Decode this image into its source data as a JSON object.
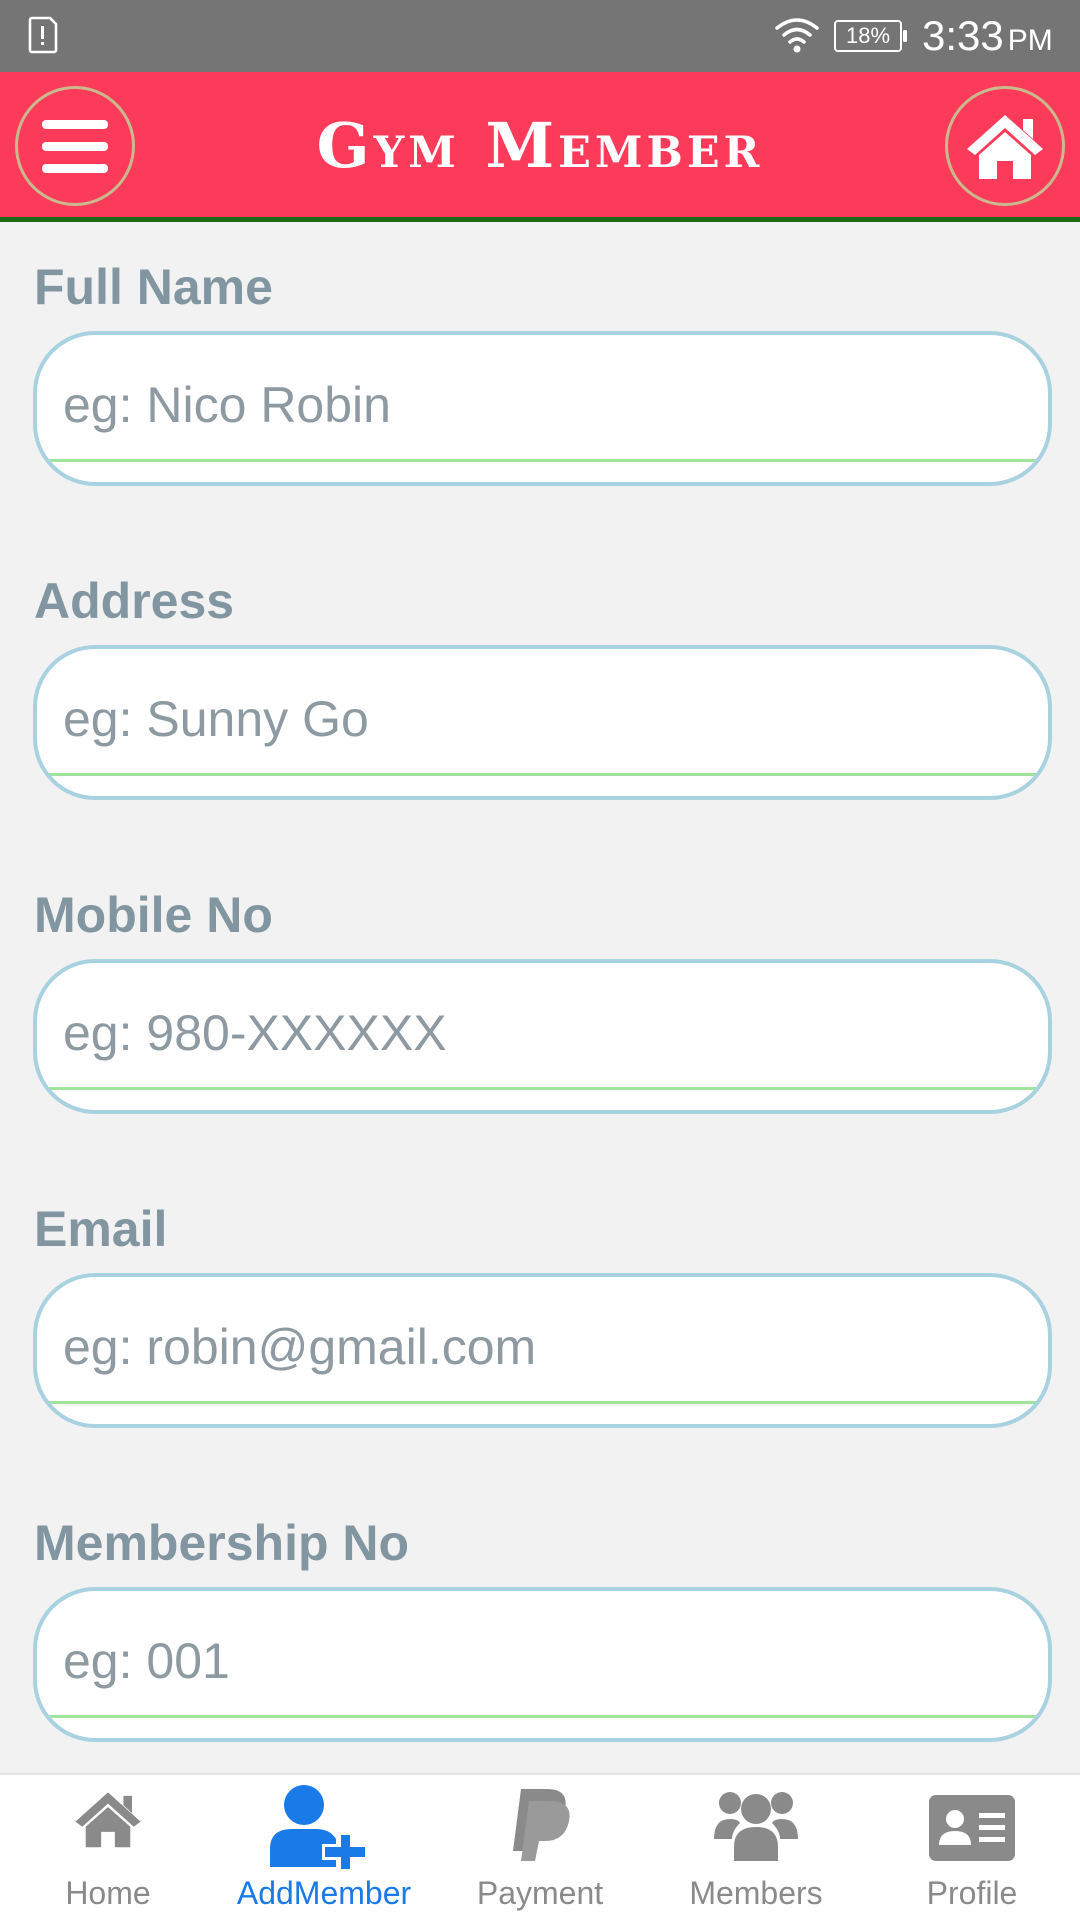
{
  "status_bar": {
    "battery": "18%",
    "time": "3:33",
    "ampm": "PM"
  },
  "header": {
    "title": "Gym Member",
    "menu_icon": "hamburger-menu-icon",
    "home_icon": "home-icon",
    "background_color": "#fc3b5a"
  },
  "form": {
    "fields": [
      {
        "label": "Full Name",
        "placeholder": "eg: Nico Robin",
        "value": ""
      },
      {
        "label": "Address",
        "placeholder": "eg: Sunny Go",
        "value": ""
      },
      {
        "label": "Mobile No",
        "placeholder": "eg: 980-XXXXXX",
        "value": ""
      },
      {
        "label": "Email",
        "placeholder": "eg: robin@gmail.com",
        "value": ""
      },
      {
        "label": "Membership No",
        "placeholder": "eg: 001",
        "value": ""
      }
    ]
  },
  "bottom_nav": {
    "active": "AddMember",
    "active_color": "#1a7be8",
    "items": [
      {
        "label": "Home",
        "icon": "home-icon"
      },
      {
        "label": "AddMember",
        "icon": "add-user-icon"
      },
      {
        "label": "Payment",
        "icon": "paypal-icon"
      },
      {
        "label": "Members",
        "icon": "users-group-icon"
      },
      {
        "label": "Profile",
        "icon": "id-card-icon"
      }
    ]
  }
}
